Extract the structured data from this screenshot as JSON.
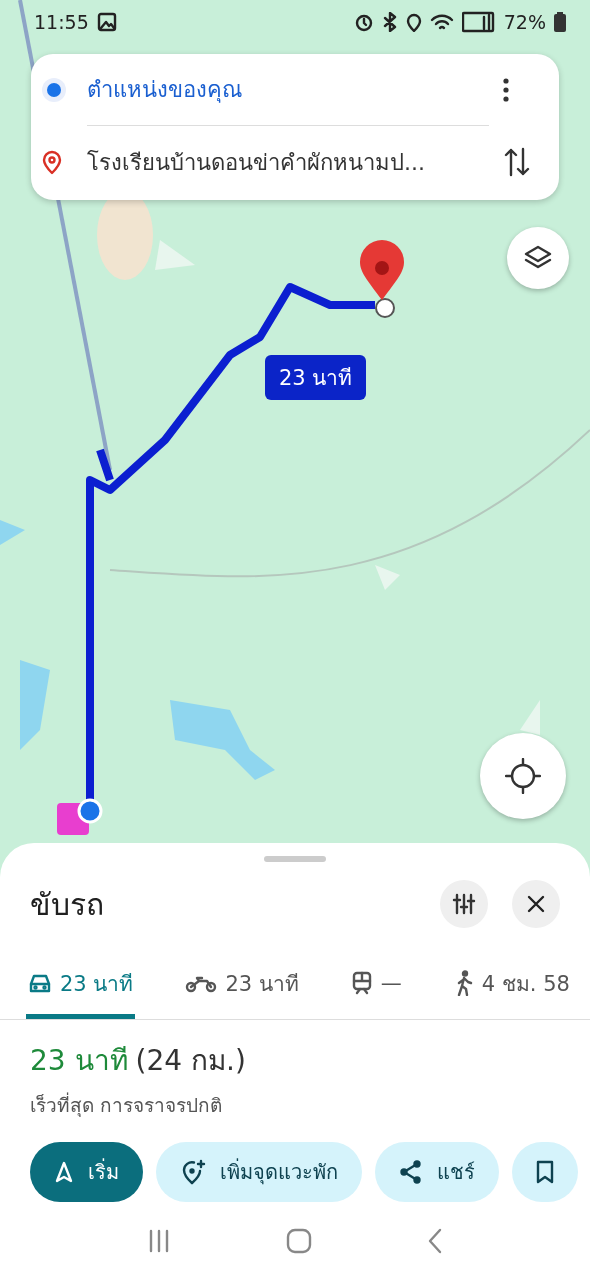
{
  "status_bar": {
    "time": "11:55",
    "battery": "72%"
  },
  "route_search": {
    "origin": "ตำแหน่งของคุณ",
    "destination": "โรงเรียนบ้านดอนข่าคำผักหนามป..."
  },
  "map": {
    "route_badge": "23 นาที"
  },
  "sheet": {
    "title": "ขับรถ",
    "modes": [
      {
        "kind": "car",
        "label": "23 นาที",
        "selected": true
      },
      {
        "kind": "motorbike",
        "label": "23 นาที",
        "selected": false
      },
      {
        "kind": "transit",
        "label": "—",
        "selected": false
      },
      {
        "kind": "walk",
        "label": "4 ชม. 58",
        "selected": false
      }
    ],
    "duration": "23 นาที",
    "distance": "(24 กม.)",
    "note": "เร็วที่สุด การจราจรปกติ",
    "actions": [
      {
        "kind": "start",
        "label": "เริ่ม"
      },
      {
        "kind": "add-stop",
        "label": "เพิ่มจุดแวะพัก"
      },
      {
        "kind": "share",
        "label": "แชร์"
      },
      {
        "kind": "save"
      }
    ]
  }
}
